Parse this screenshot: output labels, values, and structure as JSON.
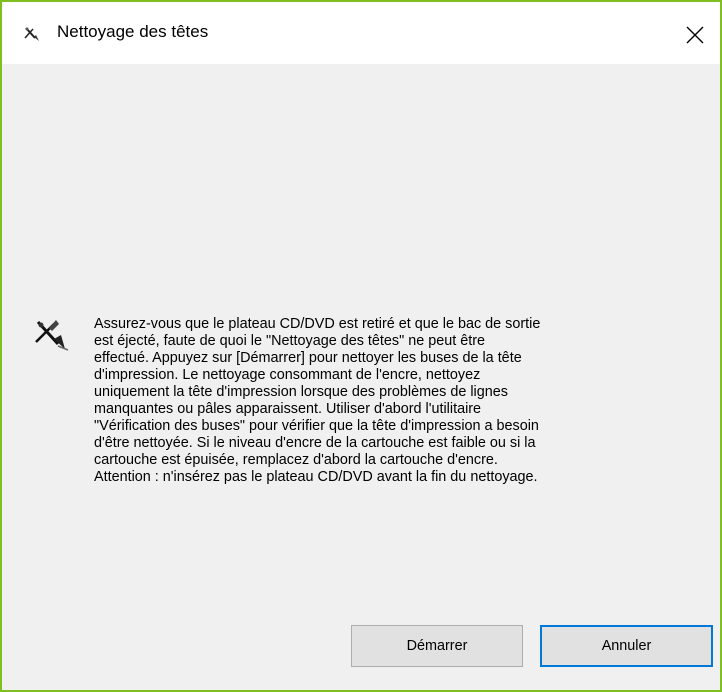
{
  "window": {
    "title": "Nettoyage des têtes"
  },
  "icons": {
    "title_icon": "head-cleaning-icon",
    "close_icon": "close-icon",
    "message_icon": "head-cleaning-icon"
  },
  "message": {
    "text": "Assurez-vous que le plateau CD/DVD est retiré et que le bac de sortie\nest éjecté, faute de quoi le \"Nettoyage des têtes\" ne peut être\neffectué. Appuyez sur [Démarrer] pour nettoyer les buses de la tête\nd'impression. Le nettoyage consommant de l'encre, nettoyez\nuniquement la tête d'impression lorsque des problèmes de lignes\nmanquantes ou pâles apparaissent. Utiliser d'abord l'utilitaire\n\"Vérification des buses\" pour vérifier que la tête d'impression a besoin\nd'être nettoyée. Si le niveau d'encre de la cartouche est faible ou si la\ncartouche est épuisée, remplacez d'abord la cartouche d'encre.\nAttention : n'insérez pas le plateau CD/DVD avant la fin du nettoyage."
  },
  "buttons": {
    "start_label": "Démarrer",
    "cancel_label": "Annuler"
  },
  "colors": {
    "window_border": "#7fbf1f",
    "dialog_background": "#f0f0f0",
    "button_background": "#e1e1e1",
    "default_button_border": "#0078d7"
  }
}
